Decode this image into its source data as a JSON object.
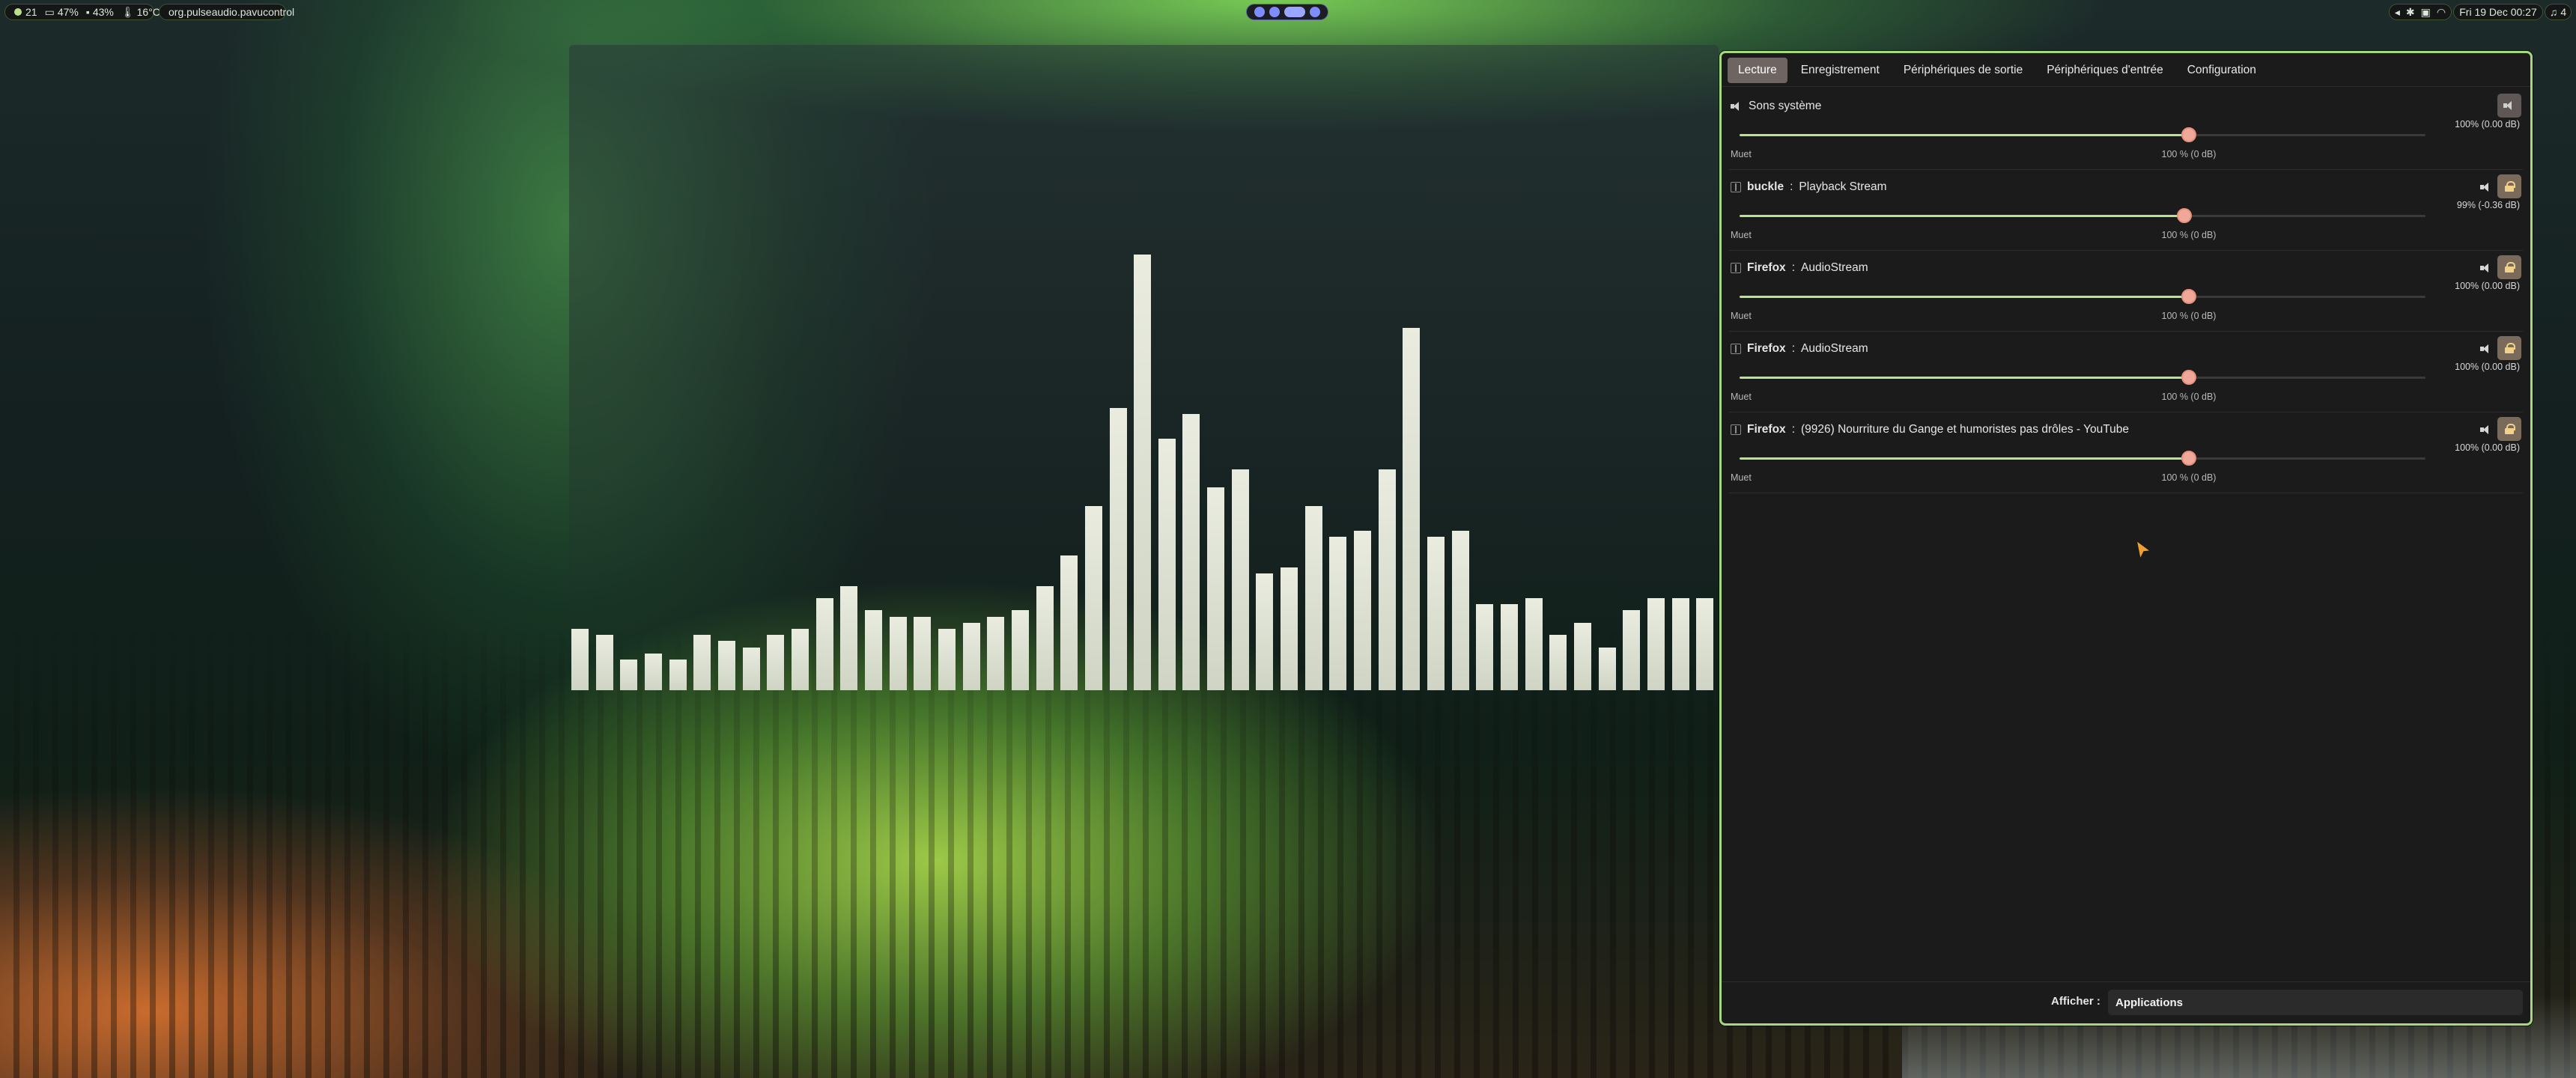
{
  "topbar": {
    "workspace_num": "21",
    "cpu": "47%",
    "battery": "43%",
    "temp": "16°C",
    "window_class": "org.pulseaudio.pavucontrol",
    "clock": "Fri 19 Dec 00:27",
    "notif_count": "4"
  },
  "pavucontrol": {
    "tabs": [
      "Lecture",
      "Enregistrement",
      "Périphériques de sortie",
      "Périphériques d'entrée",
      "Configuration"
    ],
    "active_tab": "Lecture",
    "streams": [
      {
        "app": "",
        "name": "Sons système",
        "value": "100% (0.00 dB)",
        "level": 1.0,
        "mute_label": "Muet",
        "ref_label": "100 % (0 dB)"
      },
      {
        "app": "buckle",
        "name": "Playback Stream",
        "value": "99% (-0.36 dB)",
        "level": 0.99,
        "mute_label": "Muet",
        "ref_label": "100 % (0 dB)"
      },
      {
        "app": "Firefox",
        "name": "AudioStream",
        "value": "100% (0.00 dB)",
        "level": 1.0,
        "mute_label": "Muet",
        "ref_label": "100 % (0 dB)"
      },
      {
        "app": "Firefox",
        "name": "AudioStream",
        "value": "100% (0.00 dB)",
        "level": 1.0,
        "mute_label": "Muet",
        "ref_label": "100 % (0 dB)"
      },
      {
        "app": "Firefox",
        "name": "(9926) Nourriture du Gange et humoristes pas drôles - YouTube",
        "value": "100% (0.00 dB)",
        "level": 1.0,
        "mute_label": "Muet",
        "ref_label": "100 % (0 dB)"
      }
    ],
    "footer": {
      "label": "Afficher :",
      "selected": "Applications"
    }
  },
  "visualizer": {
    "levels": [
      0.1,
      0.09,
      0.05,
      0.06,
      0.05,
      0.09,
      0.08,
      0.07,
      0.09,
      0.1,
      0.15,
      0.17,
      0.13,
      0.12,
      0.12,
      0.1,
      0.11,
      0.12,
      0.13,
      0.17,
      0.22,
      0.3,
      0.46,
      0.71,
      0.41,
      0.45,
      0.33,
      0.36,
      0.19,
      0.2,
      0.3,
      0.25,
      0.26,
      0.36,
      0.59,
      0.25,
      0.26,
      0.14,
      0.14,
      0.15,
      0.09,
      0.11,
      0.07,
      0.13,
      0.15,
      0.15,
      0.15
    ]
  },
  "colors": {
    "accent": "#a6d97e",
    "knob": "#f0a898",
    "fill": "#b7e48d"
  }
}
